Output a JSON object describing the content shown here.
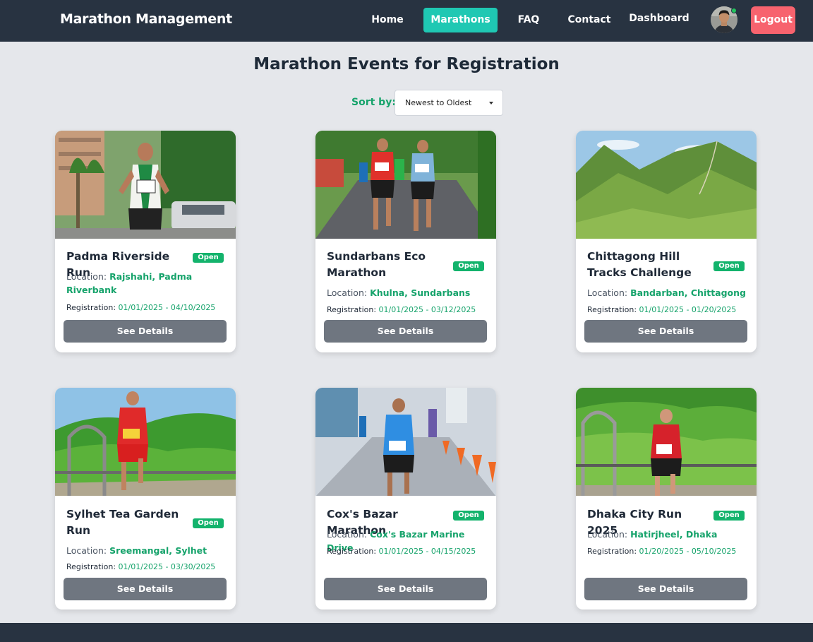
{
  "navbar": {
    "brand": "Marathon Management",
    "links": [
      "Home",
      "Marathons",
      "FAQ",
      "Contact",
      "Dashboard"
    ],
    "active_link": "Marathons",
    "logout_label": "Logout",
    "accent_color": "#1fc8b3",
    "logout_color": "#f7636e"
  },
  "page": {
    "title": "Marathon Events for Registration",
    "sort_label": "Sort by:",
    "sort_value": "Newest to Oldest"
  },
  "labels": {
    "location": "Location:",
    "registration": "Registration:",
    "status": "Open",
    "button": "See Details"
  },
  "events": [
    {
      "title": "Padma Riverside Run",
      "location": "Rajshahi, Padma Riverbank",
      "registration": "01/01/2025 - 04/10/2025"
    },
    {
      "title": "Sundarbans Eco Marathon",
      "location": "Khulna, Sundarbans",
      "registration": "01/01/2025 - 03/12/2025"
    },
    {
      "title": "Chittagong Hill Tracks Challenge",
      "location": "Bandarban, Chittagong",
      "registration": "01/01/2025 - 01/20/2025"
    },
    {
      "title": "Sylhet Tea Garden Run",
      "location": "Sreemangal, Sylhet",
      "registration": "01/01/2025 - 03/30/2025"
    },
    {
      "title": "Cox's Bazar Marathon",
      "location": "Cox's Bazar Marine Drive",
      "registration": "01/01/2025 - 04/15/2025"
    },
    {
      "title": "Dhaka City Run 2025",
      "location": "Hatirjheel, Dhaka",
      "registration": "01/20/2025 - 05/10/2025"
    }
  ]
}
